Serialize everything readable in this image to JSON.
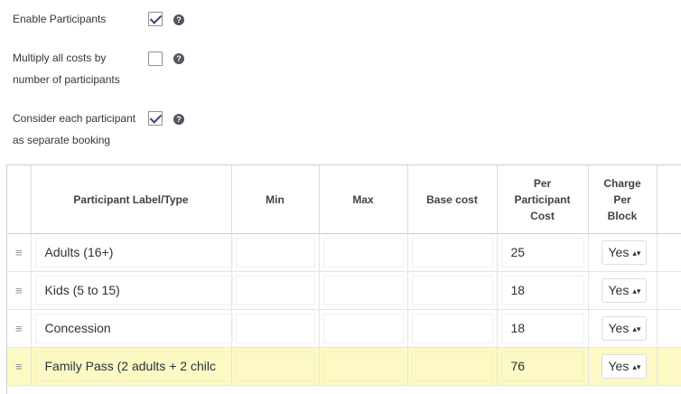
{
  "options": [
    {
      "label_line1": "Enable Participants",
      "label_line2": "",
      "checked": true
    },
    {
      "label_line1": "Multiply all costs by",
      "label_line2": "number of participants",
      "checked": false
    },
    {
      "label_line1": "Consider each participant",
      "label_line2": "as separate booking",
      "checked": true
    }
  ],
  "help_glyph": "?",
  "table": {
    "headers": {
      "label": "Participant Label/Type",
      "min": "Min",
      "max": "Max",
      "base_cost": "Base cost",
      "per_participant_cost": "Per Participant Cost",
      "charge_per_block": "Charge Per Block"
    },
    "drag_handle_glyph": "≡",
    "select_arrow_glyph": "▴▾",
    "rows": [
      {
        "label": "Adults (16+)",
        "min": "",
        "max": "",
        "base_cost": "",
        "per_participant_cost": "25",
        "charge_per_block": "Yes",
        "highlighted": false
      },
      {
        "label": "Kids (5 to 15)",
        "min": "",
        "max": "",
        "base_cost": "",
        "per_participant_cost": "18",
        "charge_per_block": "Yes",
        "highlighted": false
      },
      {
        "label": "Concession",
        "min": "",
        "max": "",
        "base_cost": "",
        "per_participant_cost": "18",
        "charge_per_block": "Yes",
        "highlighted": false
      },
      {
        "label": "Family Pass (2 adults + 2 chilc",
        "min": "",
        "max": "",
        "base_cost": "",
        "per_participant_cost": "76",
        "charge_per_block": "Yes",
        "highlighted": true
      }
    ]
  },
  "colors": {
    "checkmark": "#4a3b7a",
    "highlight_row": "#fcf9c4"
  }
}
